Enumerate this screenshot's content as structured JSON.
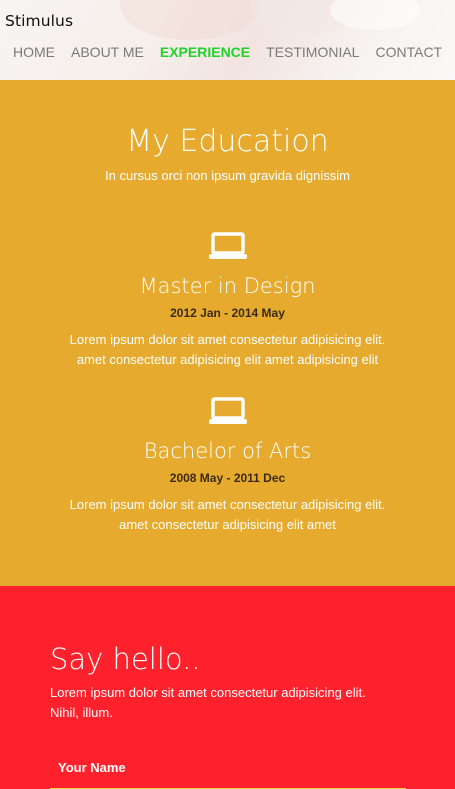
{
  "brand": "Stimulus",
  "nav": {
    "items": [
      {
        "label": "HOME"
      },
      {
        "label": "ABOUT ME"
      },
      {
        "label": "EXPERIENCE"
      },
      {
        "label": "TESTIMONIAL"
      },
      {
        "label": "CONTACT"
      }
    ],
    "active_index": 2
  },
  "education": {
    "title": "My Education",
    "subtitle": "In cursus orci non ipsum gravida dignissim",
    "entries": [
      {
        "icon": "laptop-icon",
        "title": "Master in Design",
        "date": "2012 Jan - 2014 May",
        "desc_line1": "Lorem ipsum dolor sit amet consectetur adipisicing elit.",
        "desc_line2": "amet consectetur adipisicing elit amet adipisicing elit"
      },
      {
        "icon": "laptop-icon",
        "title": "Bachelor of Arts",
        "date": "2008 May - 2011 Dec",
        "desc_line1": "Lorem ipsum dolor sit amet consectetur adipisicing elit.",
        "desc_line2": "amet consectetur adipisicing elit amet"
      }
    ]
  },
  "contact": {
    "title": "Say hello..",
    "text_line1": "Lorem ipsum dolor sit amet consectetur adipisicing elit.",
    "text_line2": "Nihil, illum.",
    "name_placeholder": "Your Name"
  },
  "colors": {
    "education_bg": "#e6ab2e",
    "contact_bg": "#ff212c",
    "nav_active": "#22d12a",
    "input_underline": "#f5d53a"
  }
}
